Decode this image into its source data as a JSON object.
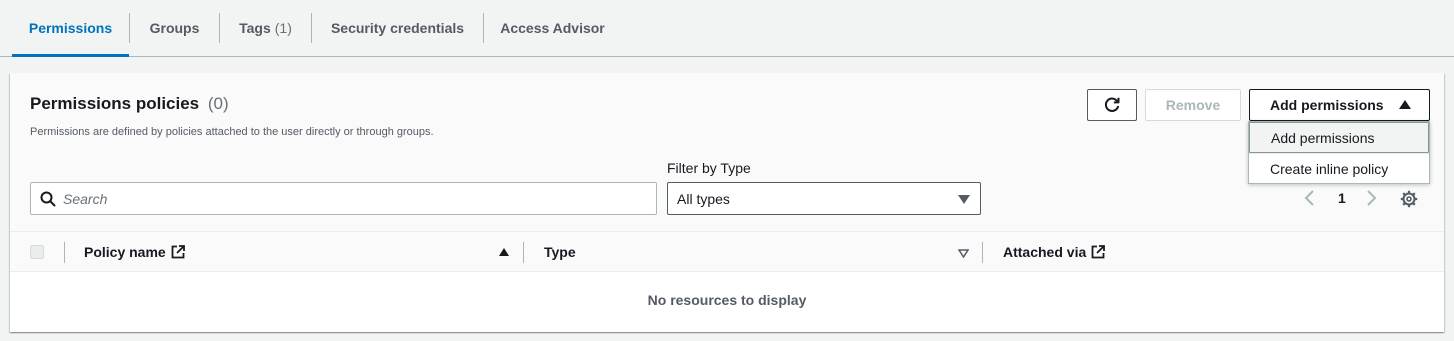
{
  "tabs": [
    {
      "label": "Permissions",
      "count": ""
    },
    {
      "label": "Groups",
      "count": ""
    },
    {
      "label": "Tags",
      "count": "(1)"
    },
    {
      "label": "Security credentials",
      "count": ""
    },
    {
      "label": "Access Advisor",
      "count": ""
    }
  ],
  "active_tab": "Permissions",
  "panel": {
    "title": "Permissions policies",
    "count": "(0)",
    "description": "Permissions are defined by policies attached to the user directly or through groups."
  },
  "buttons": {
    "refresh_icon": "refresh-icon",
    "remove": "Remove",
    "add_permissions": "Add permissions"
  },
  "dropdown": {
    "items": [
      "Add permissions",
      "Create inline policy"
    ]
  },
  "filter": {
    "label": "Filter by Type",
    "search_placeholder": "Search",
    "search_value": "",
    "selected_type": "All types"
  },
  "pagination": {
    "current_page": "1"
  },
  "table": {
    "columns": [
      "Policy name",
      "Type",
      "Attached via"
    ],
    "empty_message": "No resources to display"
  },
  "colors": {
    "accent": "#0073bb",
    "text": "#16191f",
    "muted": "#545b64",
    "border": "#aab7b8",
    "background": "#f2f3f3"
  }
}
